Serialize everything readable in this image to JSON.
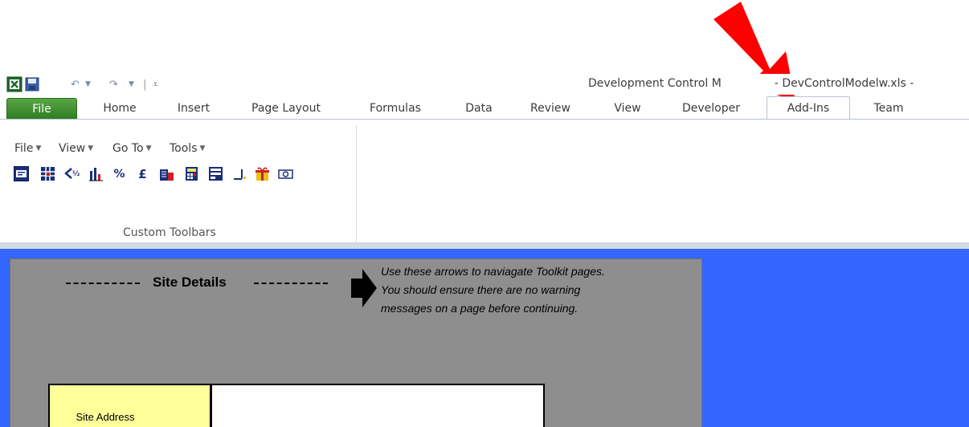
{
  "window": {
    "title": "Development Control Model - DevControlModelw.xls -",
    "title_visible": "Development Control M",
    "title_right": "- DevControlModelw.xls -"
  },
  "quick_access": {
    "icons": [
      "excel-icon",
      "save-icon",
      "undo-icon",
      "redo-icon",
      "customize-icon"
    ]
  },
  "tabs": [
    {
      "label": "File"
    },
    {
      "label": "Home"
    },
    {
      "label": "Insert"
    },
    {
      "label": "Page Layout"
    },
    {
      "label": "Formulas"
    },
    {
      "label": "Data"
    },
    {
      "label": "Review"
    },
    {
      "label": "View"
    },
    {
      "label": "Developer"
    },
    {
      "label": "Add-Ins"
    },
    {
      "label": "Team"
    }
  ],
  "ribbon": {
    "menus": [
      {
        "label": "File",
        "caret": "▼"
      },
      {
        "label": "View",
        "caret": "▼"
      },
      {
        "label": "Go To",
        "caret": "▼"
      },
      {
        "label": "Tools",
        "caret": "▼"
      }
    ],
    "group_label": "Custom Toolbars",
    "toolbar_icons": [
      "form-icon",
      "grid-icon",
      "half-arrow-icon",
      "chart-icon",
      "percent-icon",
      "pound-icon",
      "building-icon",
      "calculator-icon",
      "table-icon",
      "pen-icon",
      "gift-icon",
      "money-icon"
    ]
  },
  "sheet": {
    "site_details": "Site Details",
    "note_lines": [
      "Use these arrows to naviagate Toolkit pages.",
      "You should ensure there are no warning",
      "messages on a page before continuing."
    ],
    "site_address_label": "Site Address",
    "site_address_value": ""
  },
  "colors": {
    "file_tab": "#3f8f31",
    "sheet_background": "#3366ff",
    "panel": "#8e8e8e",
    "label_cell": "#ffff99",
    "annotation_arrow": "#ff0000"
  }
}
